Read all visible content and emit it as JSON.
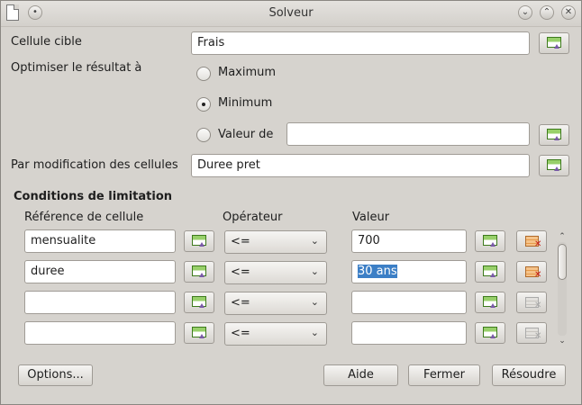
{
  "window": {
    "title": "Solveur"
  },
  "target": {
    "label": "Cellule cible",
    "value": "Frais"
  },
  "optimize": {
    "label": "Optimiser le résultat à",
    "options": [
      {
        "label": "Maximum",
        "selected": false
      },
      {
        "label": "Minimum",
        "selected": true
      },
      {
        "label": "Valeur de",
        "selected": false
      }
    ],
    "value_of": ""
  },
  "changing": {
    "label": "Par modification des cellules",
    "value": "Duree pret"
  },
  "constraints": {
    "heading": "Conditions de limitation",
    "col_ref": "Référence de cellule",
    "col_op": "Opérateur",
    "col_val": "Valeur",
    "rows": [
      {
        "ref": "mensualite",
        "op": "<=",
        "val": "700",
        "val_selected": false
      },
      {
        "ref": "duree",
        "op": "<=",
        "val": "30 ans",
        "val_selected": true
      },
      {
        "ref": "",
        "op": "<=",
        "val": "",
        "val_selected": false
      },
      {
        "ref": "",
        "op": "<=",
        "val": "",
        "val_selected": false
      }
    ]
  },
  "buttons": {
    "options": "Options...",
    "help": "Aide",
    "close": "Fermer",
    "solve": "Résoudre"
  },
  "icons": {
    "pick": "shrink-cell-picker-icon",
    "delete": "delete-constraint-icon"
  }
}
